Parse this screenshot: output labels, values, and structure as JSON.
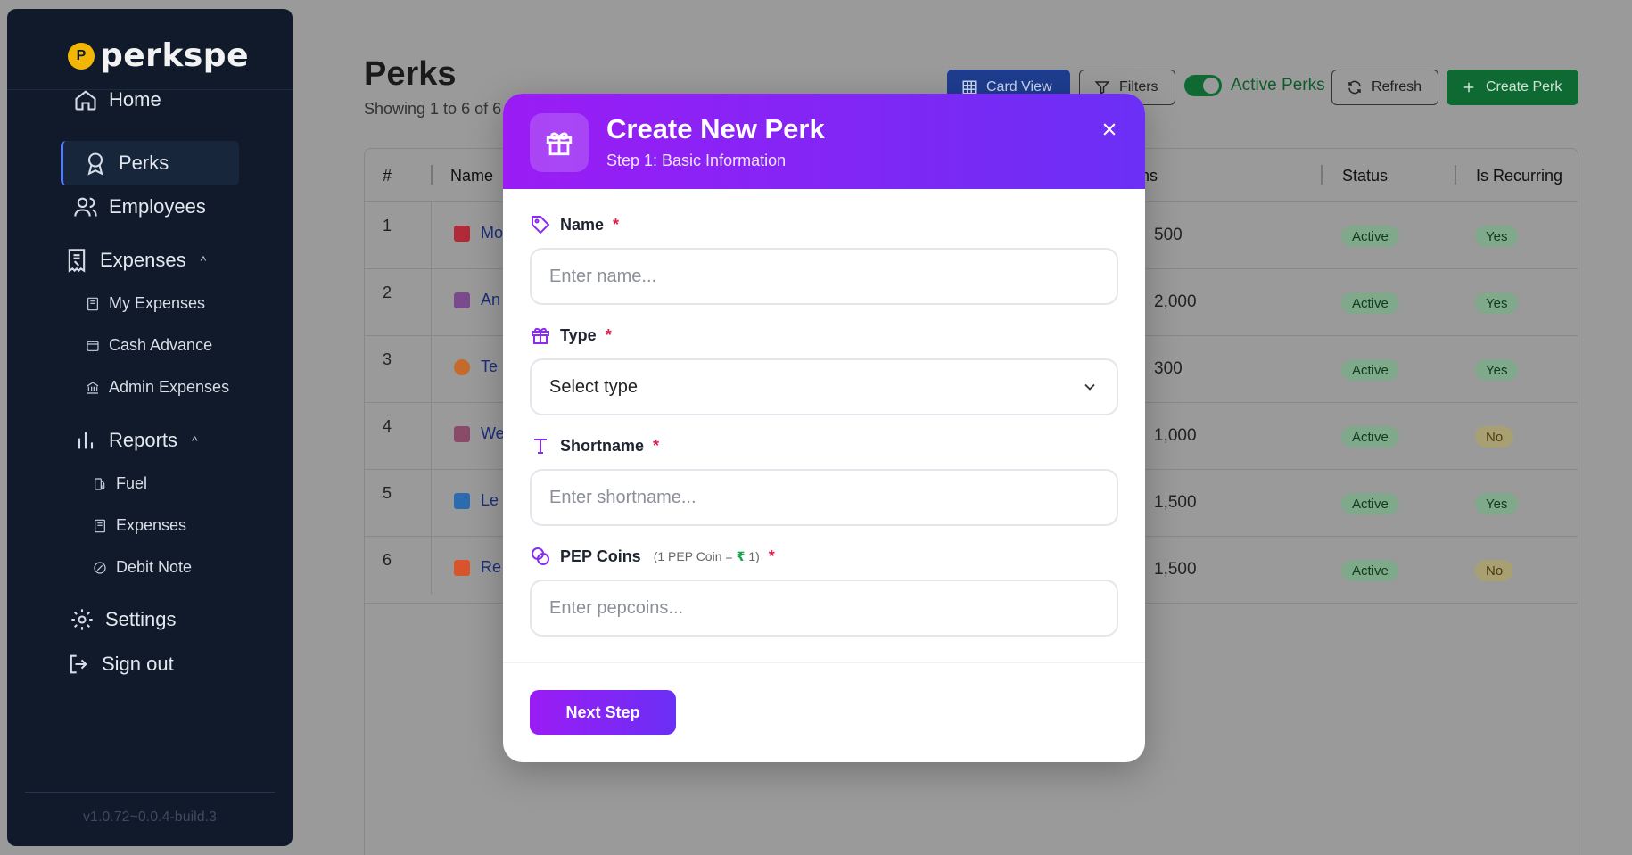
{
  "sidebar": {
    "logo_text": "perkspe",
    "logo_badge": "P",
    "items": [
      {
        "label": "Home"
      },
      {
        "label": "Perks"
      },
      {
        "label": "Employees"
      },
      {
        "label": "Expenses"
      },
      {
        "label": "Reports"
      },
      {
        "label": "Settings"
      },
      {
        "label": "Sign out"
      }
    ],
    "expenses_sub": [
      "My Expenses",
      "Cash Advance",
      "Admin Expenses"
    ],
    "reports_sub": [
      "Fuel",
      "Expenses",
      "Debit Note"
    ],
    "caret": "^",
    "version": "v1.0.72~0.0.4-build.3"
  },
  "main": {
    "title": "Perks",
    "subtitle": "Showing 1 to 6 of 6 r",
    "card_view": "Card View",
    "filters": "Filters",
    "active_perks": "Active Perks",
    "refresh": "Refresh",
    "create_perk": "Create Perk",
    "columns": {
      "num": "#",
      "name": "Name",
      "coins": "ns",
      "status": "Status",
      "recurring": "Is Recurring"
    },
    "rows": [
      {
        "num": "1",
        "name": "Mo",
        "coins": "500",
        "status": "Active",
        "recurring": "Yes",
        "color": "#b02a37"
      },
      {
        "num": "2",
        "name": "An",
        "coins": "2,000",
        "status": "Active",
        "recurring": "Yes",
        "color": "#7a4b8c"
      },
      {
        "num": "3",
        "name": "Te",
        "coins": "300",
        "status": "Active",
        "recurring": "Yes",
        "color": "#c46b2b"
      },
      {
        "num": "4",
        "name": "We",
        "coins": "1,000",
        "status": "Active",
        "recurring": "No",
        "color": "#8a4b6b"
      },
      {
        "num": "5",
        "name": "Le",
        "coins": "1,500",
        "status": "Active",
        "recurring": "Yes",
        "color": "#2b6bb0"
      },
      {
        "num": "6",
        "name": "Re",
        "coins": "1,500",
        "status": "Active",
        "recurring": "No",
        "color": "#d9542b"
      }
    ]
  },
  "modal": {
    "title": "Create New Perk",
    "step": "Step 1: Basic Information",
    "fields": {
      "name": {
        "label": "Name",
        "placeholder": "Enter name..."
      },
      "type": {
        "label": "Type",
        "value": "Select type"
      },
      "shortname": {
        "label": "Shortname",
        "placeholder": "Enter shortname..."
      },
      "pepcoins": {
        "label": "PEP Coins",
        "hint_prefix": "(1 PEP Coin =",
        "hint_symbol": "₹",
        "hint_suffix": "1)",
        "placeholder": "Enter pepcoins..."
      }
    },
    "required_mark": "*",
    "next_button": "Next Step"
  },
  "colors": {
    "accent_start": "#9b1cf5",
    "accent_end": "#6b2ff5",
    "sidebar_bg": "#101a2b",
    "green": "#0e6a32"
  }
}
